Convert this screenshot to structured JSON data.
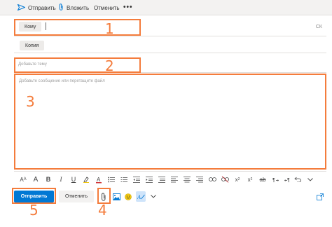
{
  "toolbar": {
    "send_label": "Отправить",
    "attach_label": "Вложить",
    "discard_label": "Отменить",
    "more_label": "•••"
  },
  "compose": {
    "to_label": "Кому",
    "bcc_label": "СК",
    "cc_label": "Копия",
    "subject_placeholder": "Добавьте тему",
    "body_placeholder": "Добавьте сообщение или перетащите файл"
  },
  "actions": {
    "send_label": "Отправить",
    "discard_label": "Отменить"
  },
  "callouts": [
    "1",
    "2",
    "3",
    "4",
    "5"
  ],
  "colors": {
    "accent": "#0078d4",
    "callout": "#f47c3c"
  }
}
